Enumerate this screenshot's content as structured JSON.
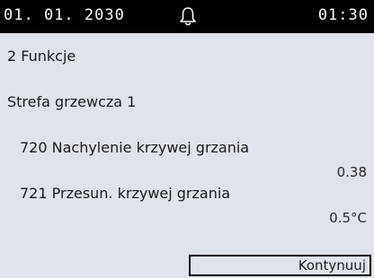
{
  "status": {
    "date": "01. 01. 2030",
    "time": "01:30",
    "bell_icon": "bell-icon"
  },
  "menu": {
    "section": "2 Funkcje",
    "zone": "Strefa grzewcza 1"
  },
  "parameters": [
    {
      "label": "720 Nachylenie krzywej grzania",
      "value": "0.38"
    },
    {
      "label": "721 Przesun. krzywej grzania",
      "value": "0.5°C"
    }
  ],
  "actions": {
    "continue_label": "Kontynuuj"
  },
  "colors": {
    "background": "#dfe3ea",
    "statusbar": "#000000",
    "text": "#1c1c1c"
  }
}
